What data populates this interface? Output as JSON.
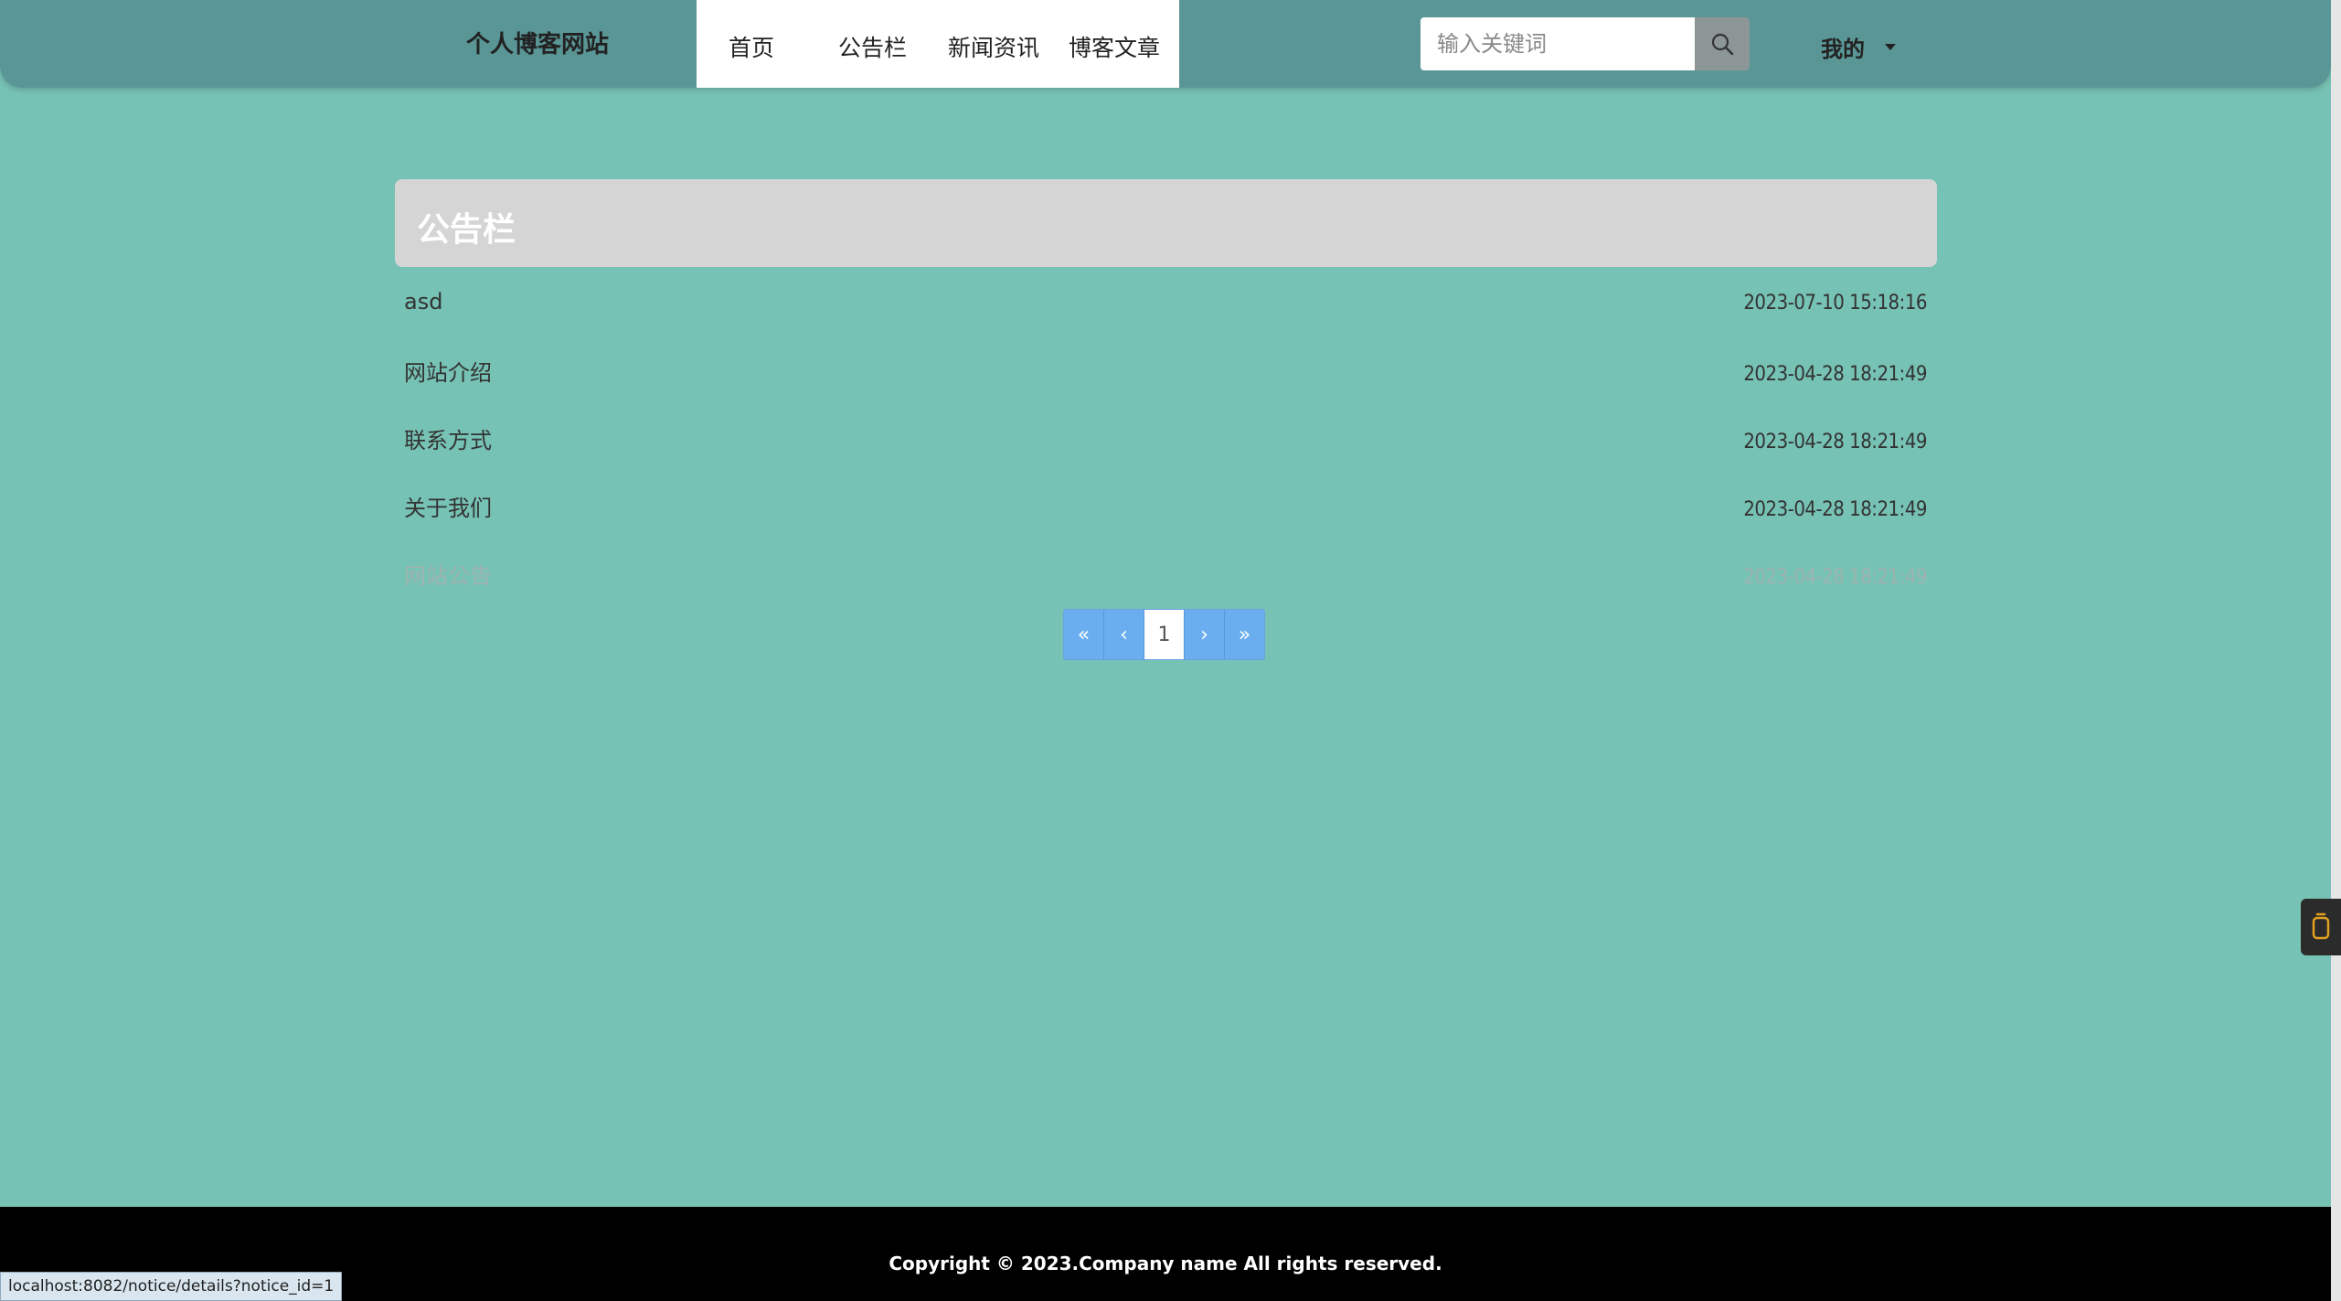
{
  "header": {
    "brand": "个人博客网站",
    "nav": [
      "首页",
      "公告栏",
      "新闻资讯",
      "博客文章"
    ],
    "search_placeholder": "输入关键词",
    "user_menu": "我的"
  },
  "panel": {
    "title": "公告栏"
  },
  "notices": [
    {
      "title": "asd",
      "time": "2023-07-10 15:18:16"
    },
    {
      "title": "网站介绍",
      "time": "2023-04-28 18:21:49"
    },
    {
      "title": "联系方式",
      "time": "2023-04-28 18:21:49"
    },
    {
      "title": "关于我们",
      "time": "2023-04-28 18:21:49"
    },
    {
      "title": "网站公告",
      "time": "2023-04-28 18:21:49"
    }
  ],
  "pagination": {
    "first": "«",
    "prev": "‹",
    "current": "1",
    "next": "›",
    "last": "»"
  },
  "footer": {
    "copyright": "Copyright © 2023.Company name All rights reserved."
  },
  "status_url": "localhost:8082/notice/details?notice_id=1",
  "icons": {
    "search": "search-icon",
    "side_widget": "side-widget-icon"
  }
}
